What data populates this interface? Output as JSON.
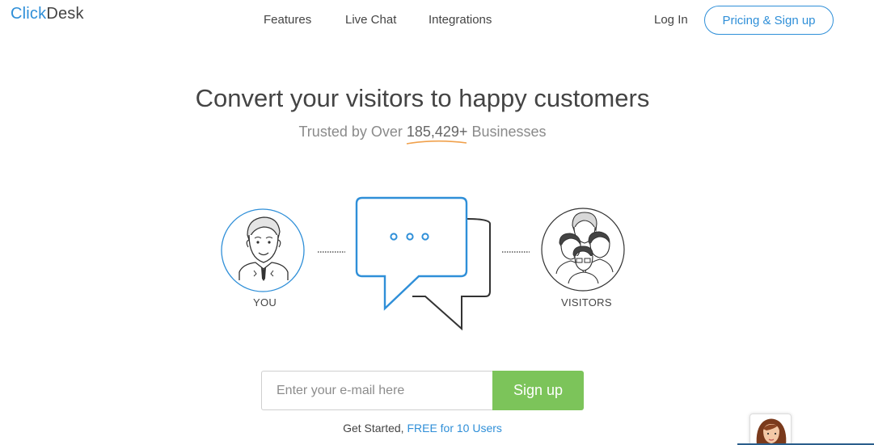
{
  "header": {
    "logo_part1": "Click",
    "logo_part2": "Desk",
    "nav": {
      "features": "Features",
      "live_chat": "Live Chat",
      "integrations": "Integrations"
    },
    "login": "Log In",
    "pricing": "Pricing & Sign up"
  },
  "hero": {
    "title": "Convert your visitors to happy customers",
    "sub_prefix": "Trusted by Over ",
    "sub_count": "185,429+",
    "sub_suffix": " Businesses"
  },
  "illustration": {
    "you_label": "YOU",
    "visitors_label": "VISITORS",
    "icons": [
      "agent-avatar-icon",
      "chat-bubble-icon",
      "visitors-group-icon"
    ]
  },
  "signup": {
    "email_placeholder": "Enter your e-mail here",
    "email_value": "",
    "button": "Sign up",
    "note_prefix": "Get Started, ",
    "note_link": "FREE for 10 Users"
  },
  "colors": {
    "brand_blue": "#2f8fd8",
    "signup_green": "#7cc45a",
    "underline_orange": "#f0a04b",
    "text_dark": "#444444"
  }
}
